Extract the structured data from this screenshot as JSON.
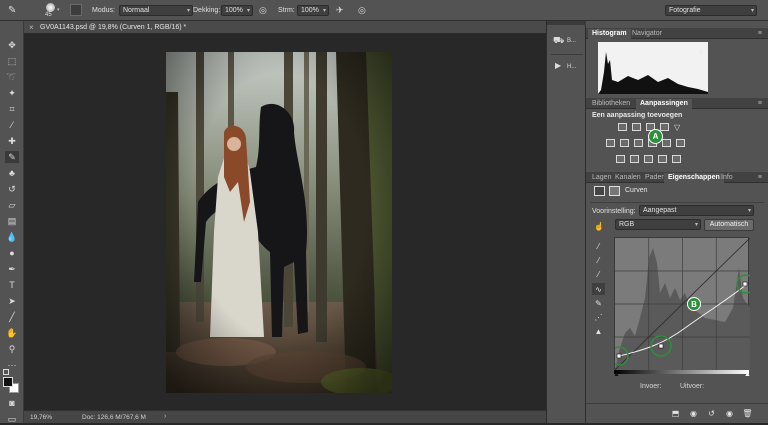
{
  "options_bar": {
    "brush_size": "45",
    "mode_label": "Modus:",
    "mode_value": "Normaal",
    "opacity_label": "Dekking:",
    "opacity_value": "100%",
    "flow_label": "Strm:",
    "flow_value": "100%",
    "workspace_value": "Fotografie"
  },
  "document": {
    "tab_title": "GV0A1143.psd @ 19,8% (Curven 1, RGB/16) *",
    "zoom": "19,76%",
    "doc_info": "Doc: 126,6 M/767,6 M"
  },
  "dock": {
    "items": [
      {
        "label": "B..."
      },
      {
        "label": "H..."
      }
    ]
  },
  "panels": {
    "histogram_tabs": [
      "Histogram",
      "Navigator"
    ],
    "adjust_tabs": [
      "Bibliotheken",
      "Aanpassingen"
    ],
    "adjust_add_label": "Een aanpassing toevoegen",
    "props_tabs": [
      "Lagen",
      "Kanalen",
      "Paden",
      "Eigenschappen",
      "Info"
    ],
    "props_title": "Curven",
    "preset_label": "Voorinstelling:",
    "preset_value": "Aangepast",
    "channel_value": "RGB",
    "auto_button": "Automatisch",
    "input_label": "Invoer:",
    "output_label": "Uitvoer:",
    "marker_a": "A",
    "marker_b": "B"
  },
  "colors": {
    "accent_marker": "#2d8f3a",
    "panel_bg": "#535353",
    "canvas_bg": "#282828"
  }
}
